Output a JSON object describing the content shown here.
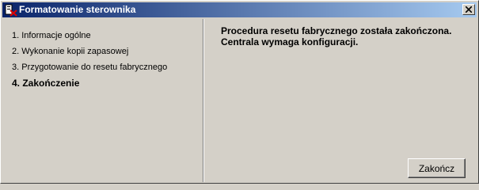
{
  "window": {
    "title": "Formatowanie sterownika",
    "icon": "app-icon",
    "close_icon": "close-icon"
  },
  "steps": [
    {
      "label": "1. Informacje ogólne"
    },
    {
      "label": "2. Wykonanie kopii zapasowej"
    },
    {
      "label": "3. Przygotowanie do resetu fabrycznego"
    },
    {
      "label": "4. Zakończenie",
      "active": true
    }
  ],
  "message": {
    "line1": "Procedura resetu fabrycznego została zakończona.",
    "line2": "Centrala wymaga konfiguracji."
  },
  "buttons": {
    "finish_label": "Zakończ"
  },
  "colors": {
    "titlebar_start": "#0a246a",
    "titlebar_end": "#a6caf0",
    "face": "#d4d0c8"
  }
}
